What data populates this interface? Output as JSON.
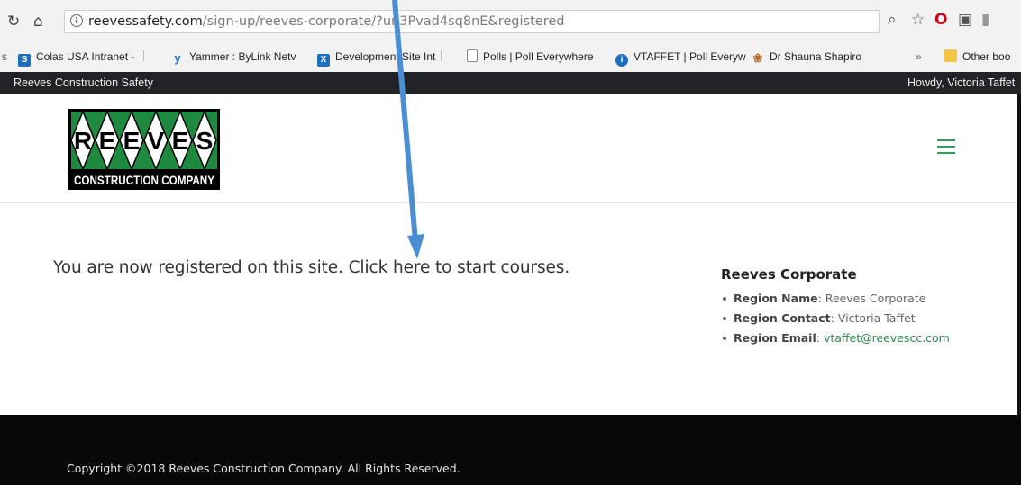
{
  "browser": {
    "url_host": "reevessafety.com",
    "url_path": "/sign-up/reeves-corporate/?un3Pvad4sq8nE&registered",
    "bookmarks": [
      {
        "label": "Colas USA Intranet - ",
        "icon": "sharepoint-icon",
        "color": "#1e6fc0"
      },
      {
        "label": "Yammer : ByLink Netv",
        "icon": "yammer-icon",
        "color": "#1e6fc0"
      },
      {
        "label": "Development Site Int",
        "icon": "x-icon",
        "color": "#1e6fc0"
      },
      {
        "label": "Polls | Poll Everywhere",
        "icon": "page-icon",
        "color": "#777777"
      },
      {
        "label": "VTAFFET | Poll Everyw",
        "icon": "poll-icon",
        "color": "#1e6fc0"
      },
      {
        "label": "Dr Shauna Shapiro",
        "icon": "leaf-icon",
        "color": "#b5651d"
      }
    ],
    "overflow_label": "»",
    "other_bookmarks": "Other boo"
  },
  "adminbar": {
    "site_name": "Reeves Construction Safety",
    "greeting": "Howdy, Victoria Taffet"
  },
  "header": {
    "logo_letters": [
      "R",
      "E",
      "E",
      "V",
      "E",
      "S"
    ],
    "logo_subtitle": "CONSTRUCTION COMPANY"
  },
  "main": {
    "message": "You are now registered on this site. Click here to start courses."
  },
  "sidebar": {
    "title": "Reeves Corporate",
    "items": [
      {
        "label": "Region Name",
        "value": "Reeves Corporate"
      },
      {
        "label": "Region Contact",
        "value": "Victoria Taffet"
      },
      {
        "label": "Region Email",
        "value": "vtaffet@reevescc.com"
      }
    ]
  },
  "footer": {
    "copyright": "Copyright ©2018 Reeves Construction Company. All Rights Reserved."
  },
  "colors": {
    "brand_green": "#2ea05a",
    "admin_bar": "#222326",
    "footer": "#080808",
    "arrow": "#4a8fd4"
  }
}
